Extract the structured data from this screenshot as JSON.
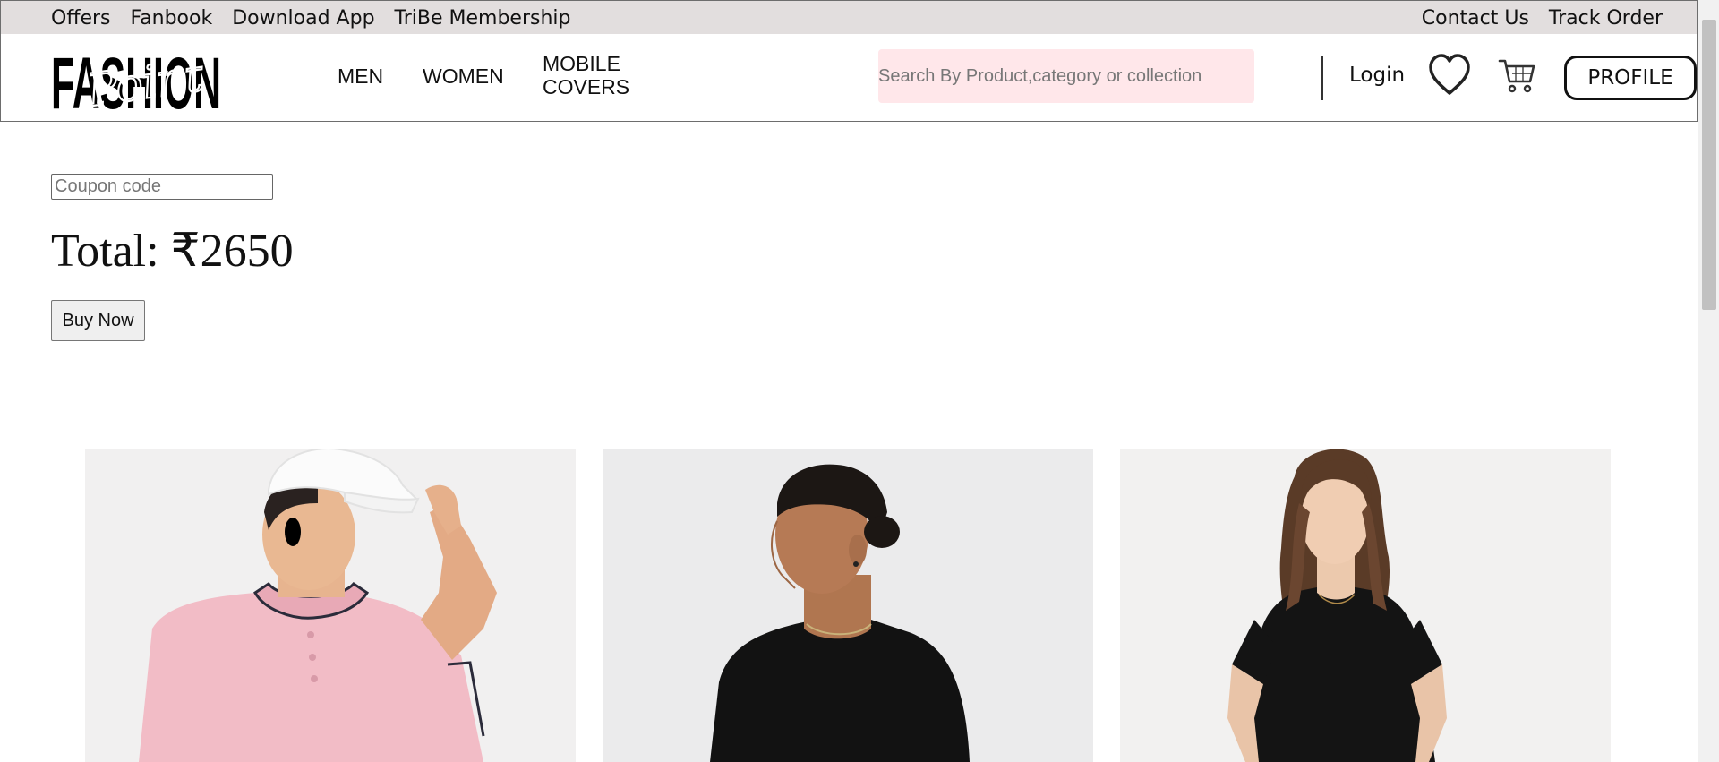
{
  "top_bar": {
    "left_links": [
      "Offers",
      "Fanbook",
      "Download App",
      "TriBe Membership"
    ],
    "right_links": [
      "Contact Us",
      "Track Order"
    ]
  },
  "header": {
    "logo_text": "FASHION",
    "logo_script": "Point",
    "nav": {
      "men": "MEN",
      "women": "WOMEN",
      "mobile_covers": "MOBILE COVERS"
    },
    "search": {
      "placeholder": "Search By Product,category or collection",
      "value": ""
    },
    "login_label": "Login",
    "profile_label": "PROFILE",
    "icons": {
      "wishlist": "heart-icon",
      "cart": "cart-icon"
    }
  },
  "checkout": {
    "coupon_placeholder": "Coupon code",
    "coupon_value": "",
    "total_label": "Total: ₹2650",
    "buy_label": "Buy Now"
  },
  "products": [
    {
      "image": "man in white cap and pink polo shirt",
      "shirt_color": "#f2bcc6"
    },
    {
      "image": "man in black t-shirt, profile view",
      "shirt_color": "#121212"
    },
    {
      "image": "woman in black oversized t-shirt dress",
      "shirt_color": "#141414"
    }
  ],
  "colors": {
    "top_bar_bg": "#e2dede",
    "search_bg": "#ffe7ea",
    "text": "#111111"
  }
}
